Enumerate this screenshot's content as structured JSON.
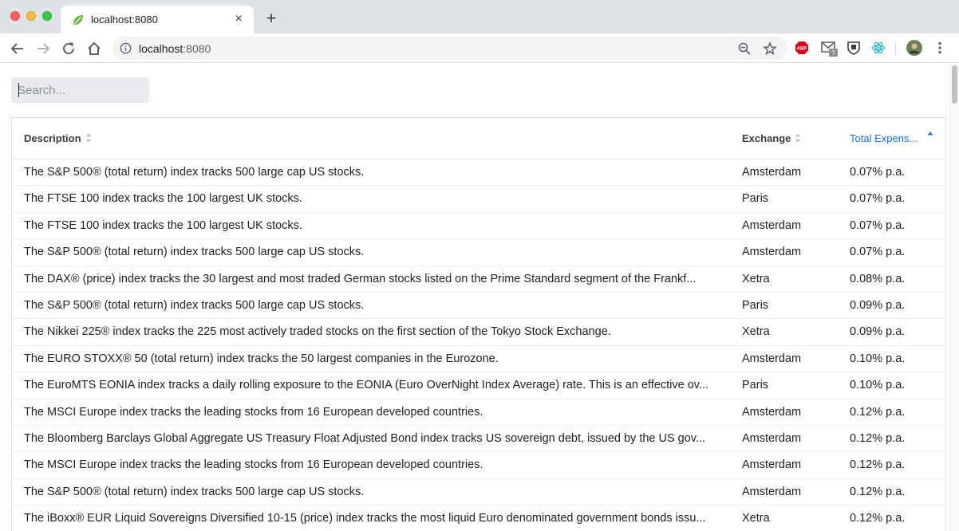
{
  "browser": {
    "tab_title": "localhost:8080",
    "url_host": "localhost",
    "url_port": ":8080",
    "new_tab_label": "+",
    "tab_close_label": "×"
  },
  "search": {
    "placeholder": "Search..."
  },
  "table": {
    "columns": [
      {
        "label": "Description",
        "sort": "none"
      },
      {
        "label": "Exchange",
        "sort": "none"
      },
      {
        "label": "Total Expens...",
        "sort": "ascending"
      }
    ],
    "rows": [
      {
        "description": "The S&P 500® (total return) index tracks 500 large cap US stocks.",
        "exchange": "Amsterdam",
        "ter": "0.07% p.a."
      },
      {
        "description": "The FTSE 100 index tracks the 100 largest UK stocks.",
        "exchange": "Paris",
        "ter": "0.07% p.a."
      },
      {
        "description": "The FTSE 100 index tracks the 100 largest UK stocks.",
        "exchange": "Amsterdam",
        "ter": "0.07% p.a."
      },
      {
        "description": "The S&P 500® (total return) index tracks 500 large cap US stocks.",
        "exchange": "Amsterdam",
        "ter": "0.07% p.a."
      },
      {
        "description": "The DAX® (price) index tracks the 30 largest and most traded German stocks listed on the Prime Standard segment of the Frankf...",
        "exchange": "Xetra",
        "ter": "0.08% p.a."
      },
      {
        "description": "The S&P 500® (total return) index tracks 500 large cap US stocks.",
        "exchange": "Paris",
        "ter": "0.09% p.a."
      },
      {
        "description": "The Nikkei 225® index tracks the 225 most actively traded stocks on the first section of the Tokyo Stock Exchange.",
        "exchange": "Xetra",
        "ter": "0.09% p.a."
      },
      {
        "description": "The EURO STOXX® 50 (total return) index tracks the 50 largest companies in the Eurozone.",
        "exchange": "Amsterdam",
        "ter": "0.10% p.a."
      },
      {
        "description": "The EuroMTS EONIA index tracks a daily rolling exposure to the EONIA (Euro OverNight Index Average) rate. This is an effective ov...",
        "exchange": "Paris",
        "ter": "0.10% p.a."
      },
      {
        "description": "The MSCI Europe index tracks the leading stocks from 16 European developed countries.",
        "exchange": "Amsterdam",
        "ter": "0.12% p.a."
      },
      {
        "description": "The Bloomberg Barclays Global Aggregate US Treasury Float Adjusted Bond index tracks US sovereign debt, issued by the US gov...",
        "exchange": "Amsterdam",
        "ter": "0.12% p.a."
      },
      {
        "description": "The MSCI Europe index tracks the leading stocks from 16 European developed countries.",
        "exchange": "Amsterdam",
        "ter": "0.12% p.a."
      },
      {
        "description": "The S&P 500® (total return) index tracks 500 large cap US stocks.",
        "exchange": "Amsterdam",
        "ter": "0.12% p.a."
      },
      {
        "description": "The iBoxx® EUR Liquid Sovereigns Diversified 10-15 (price) index tracks the most liquid Euro denominated government bonds issu...",
        "exchange": "Xetra",
        "ter": "0.12% p.a."
      }
    ]
  },
  "colors": {
    "accent": "#1a73e8",
    "favicon": "#6db33f"
  },
  "icons": {
    "extensions": [
      "adblock-plus-icon",
      "gmail-checker-icon",
      "privacy-badger-icon",
      "react-devtools-icon",
      "profile-avatar-icon"
    ],
    "extension_texts": {
      "adblock": "ABP",
      "gmail_badge": "?"
    }
  }
}
